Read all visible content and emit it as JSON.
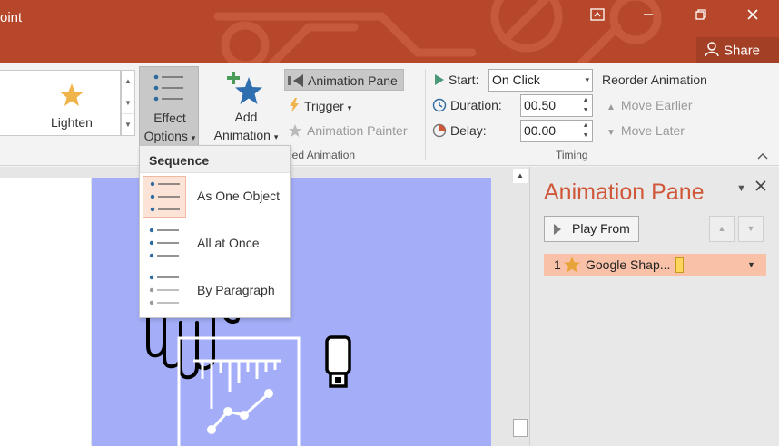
{
  "window": {
    "app_title": "oint",
    "share_label": "Share"
  },
  "ribbon": {
    "gallery": {
      "effect_label": "Lighten"
    },
    "effect_options": {
      "line1": "Effect",
      "line2": "Options"
    },
    "add_animation": {
      "line1": "Add",
      "line2": "Animation"
    },
    "advanced": {
      "animation_pane": "Animation Pane",
      "trigger": "Trigger",
      "animation_painter": "Animation Painter",
      "group_label": "nced Animation"
    },
    "timing": {
      "start_label": "Start:",
      "start_value": "On Click",
      "duration_label": "Duration:",
      "duration_value": "00.50",
      "delay_label": "Delay:",
      "delay_value": "00.00",
      "reorder_label": "Reorder Animation",
      "move_earlier": "Move Earlier",
      "move_later": "Move Later",
      "group_label": "Timing"
    }
  },
  "sequence_menu": {
    "header": "Sequence",
    "items": [
      {
        "label": "As One Object",
        "selected": true
      },
      {
        "label": "All at Once",
        "selected": false
      },
      {
        "label": "By Paragraph",
        "selected": false
      }
    ]
  },
  "animation_pane": {
    "title": "Animation Pane",
    "play_from": "Play From",
    "items": [
      {
        "number": "1",
        "icon": "star-icon",
        "name": "Google Shap..."
      }
    ]
  },
  "colors": {
    "title_bar": "#b7472a",
    "slide_background": "#a4aef8",
    "accent": "#d0583a",
    "selection_highlight": "#f9c2a8"
  }
}
